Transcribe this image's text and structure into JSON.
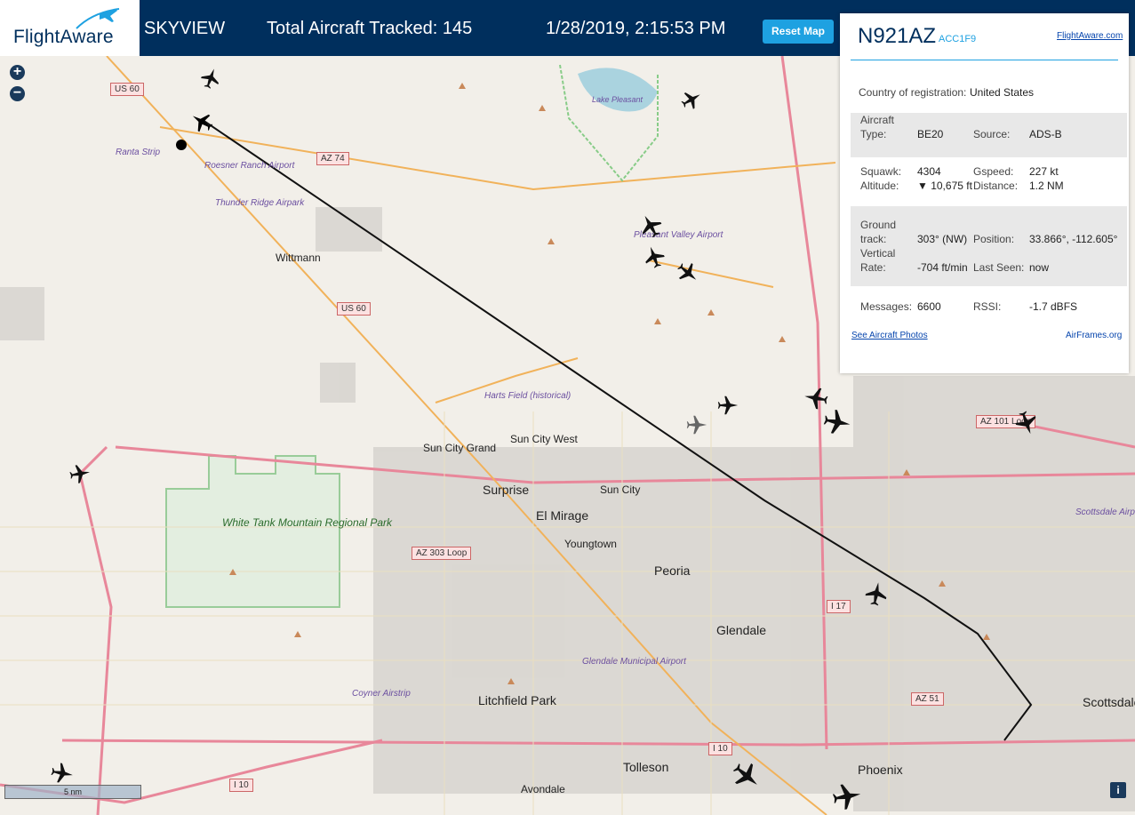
{
  "header": {
    "logo_text": "FlightAware",
    "app_name": "SKYVIEW",
    "tracked_label": "Total Aircraft Tracked: 145",
    "datetime": "1/28/2019, 2:15:53 PM",
    "reset_button": "Reset Map"
  },
  "zoom": {
    "plus": "+",
    "minus": "−"
  },
  "scale_bar": "5 nm",
  "info_button": "i",
  "panel": {
    "ident": "N921AZ",
    "hex": "ACC1F9",
    "link": "FlightAware.com",
    "country_label": "Country of registration:",
    "country_value": "United States",
    "aircraft_type_label": "Aircraft Type:",
    "aircraft_type_value": "BE20",
    "source_label": "Source:",
    "source_value": "ADS-B",
    "squawk_label": "Squawk:",
    "squawk_value": "4304",
    "gspeed_label": "Gspeed:",
    "gspeed_value": "227 kt",
    "altitude_label": "Altitude:",
    "altitude_value": "▼ 10,675 ft",
    "distance_label": "Distance:",
    "distance_value": "1.2 NM",
    "ground_track_label": "Ground track:",
    "ground_track_value": "303° (NW)",
    "position_label": "Position:",
    "position_value": "33.866°, -112.605°",
    "vertical_rate_label": "Vertical Rate:",
    "vertical_rate_value": "-704 ft/min",
    "last_seen_label": "Last Seen:",
    "last_seen_value": "now",
    "messages_label": "Messages:",
    "messages_value": "6600",
    "rssi_label": "RSSI:",
    "rssi_value": "-1.7 dBFS",
    "photos_link": "See Aircraft Photos",
    "airframes_link": "AirFrames.org"
  },
  "map": {
    "places": [
      "Wittmann",
      "Sun City Grand",
      "Sun City West",
      "Surprise",
      "Sun City",
      "El Mirage",
      "Youngtown",
      "Peoria",
      "Glendale",
      "Litchfield Park",
      "Tolleson",
      "Avondale",
      "Phoenix",
      "Scottsdale"
    ],
    "airports": [
      "Ranta Strip",
      "Roesner Ranch Airport",
      "Thunder Ridge Airpark",
      "Pleasant Valley Airport",
      "Harts Field (historical)",
      "Glendale Municipal Airport",
      "Coyner Airstrip",
      "Scottsdale Airport"
    ],
    "water": "Lake Pleasant",
    "park": "White Tank Mountain Regional Park",
    "shields": [
      "US 60",
      "AZ 74",
      "US 60",
      "AZ 303 Loop",
      "I 17",
      "AZ 101 Loop",
      "AZ 51",
      "I 10",
      "I 10"
    ]
  },
  "colors": {
    "header_bg": "#002f5d",
    "accent": "#1ea1e1",
    "track": "#111111"
  }
}
